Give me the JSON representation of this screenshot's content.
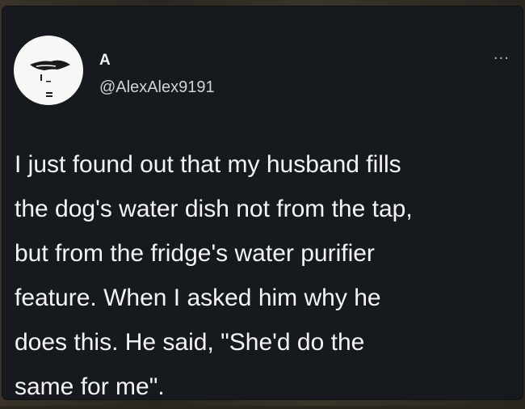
{
  "tweet": {
    "author_name": "A",
    "author_handle": "@AlexAlex9191",
    "more_menu": "···",
    "lines": [
      "I just found out that my husband fills",
      "the dog's water dish not from the tap,",
      "but from the fridge's water purifier",
      "feature. When I asked him why he",
      "does this. He said,  \"She'd do the",
      "same for me\"."
    ]
  },
  "colors": {
    "card_background": "#16191e",
    "text_primary": "#f4f4f4",
    "text_secondary": "#cfd3d8",
    "avatar_background": "#f7f7f5"
  },
  "icons": {
    "avatar": "profile-avatar-icon",
    "more": "more-options-icon"
  }
}
